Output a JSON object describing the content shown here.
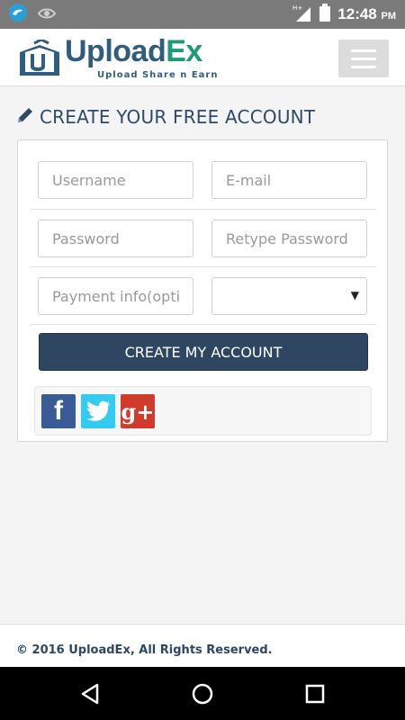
{
  "status_bar": {
    "time": "12:48",
    "ampm": "PM",
    "network": "H+",
    "icons": [
      "bird-notification-icon",
      "eye-icon",
      "signal-icon",
      "battery-icon"
    ]
  },
  "header": {
    "logo_text_upload": "Upload",
    "logo_text_ex": "Ex",
    "logo_tagline": "Upload Share n Earn",
    "menu_icon": "hamburger-icon"
  },
  "page": {
    "heading": "CREATE YOUR FREE ACCOUNT",
    "heading_icon": "pencil-icon"
  },
  "form": {
    "username_placeholder": "Username",
    "email_placeholder": "E-mail",
    "password_placeholder": "Password",
    "retype_password_placeholder": "Retype Password",
    "payment_placeholder": "Payment info(optional)",
    "payment_method_value": "",
    "submit_label": "CREATE MY ACCOUNT"
  },
  "social": {
    "facebook": "f",
    "twitter": "twitter-bird-icon",
    "google_plus": "g+"
  },
  "footer": {
    "copyright": "© 2016 UploadEx, All Rights Reserved."
  },
  "colors": {
    "primary": "#2e4661",
    "brand_blue": "#2f5d7d",
    "brand_green": "#1d9a76",
    "facebook": "#3b5a98",
    "twitter": "#33ccf0",
    "google_plus": "#d13b2b"
  }
}
